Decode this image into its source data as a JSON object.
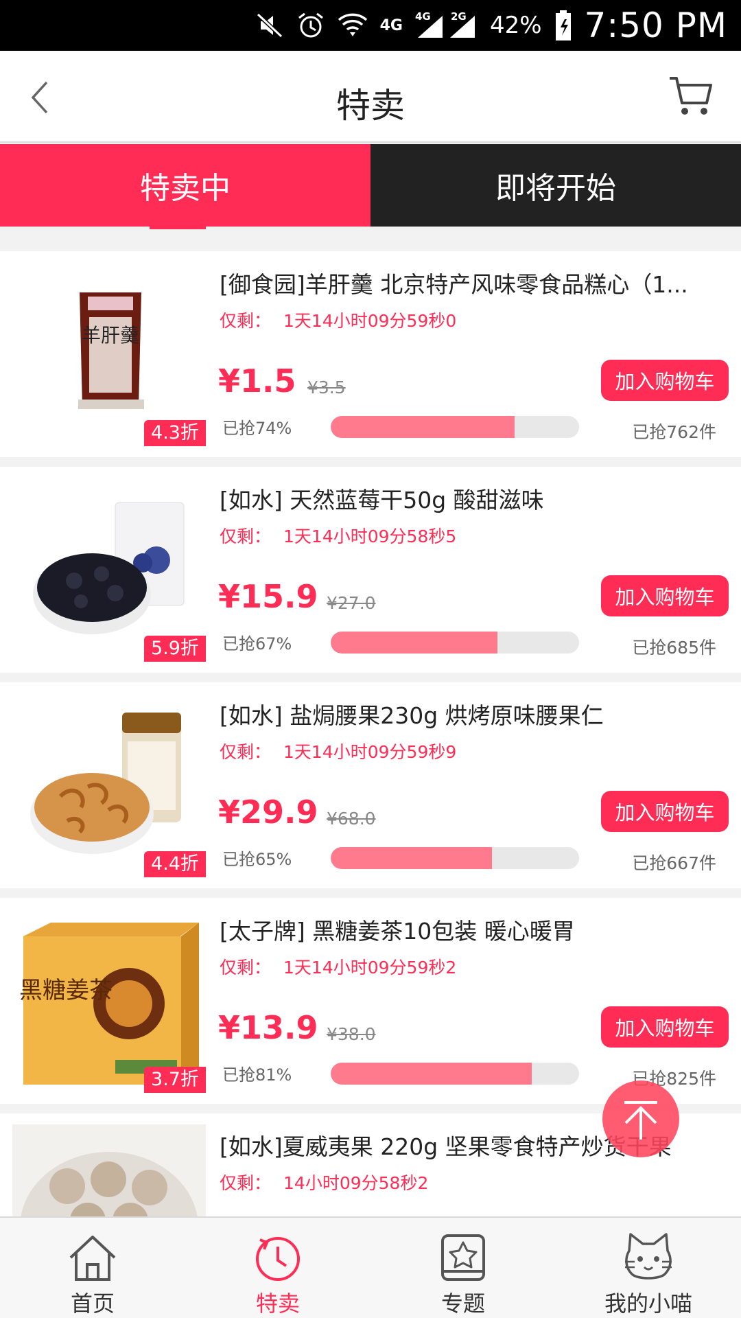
{
  "status_bar": {
    "network_1": "4G",
    "network_2": "4G",
    "network_3": "2G",
    "battery": "42%",
    "time": "7:50 PM",
    "icons": [
      "mute-icon",
      "alarm-icon",
      "wifi-icon",
      "signal-icon",
      "battery-icon"
    ]
  },
  "nav": {
    "title": "特卖",
    "back_icon": "chevron-left-icon",
    "cart_icon": "cart-icon"
  },
  "tabs": [
    {
      "label": "特卖中",
      "active": true
    },
    {
      "label": "即将开始",
      "active": false
    }
  ],
  "colors": {
    "accent": "#ff2d55",
    "tab_inactive": "#222222",
    "progress_fill": "#ff7a8c"
  },
  "products": [
    {
      "title": "[御食园]羊肝羹  北京特产风味零食品糕心（1...",
      "countdown_label": "仅剩：",
      "countdown": "1天14小时09分59秒0",
      "price": "¥1.5",
      "original_price": "¥3.5",
      "discount": "4.3折",
      "sold_percent_label": "已抢74%",
      "sold_fraction": 0.74,
      "sold_count": "已抢762件",
      "button": "加入购物车",
      "image_text": "羊肝羹"
    },
    {
      "title": "[如水] 天然蓝莓干50g 酸甜滋味",
      "countdown_label": "仅剩：",
      "countdown": "1天14小时09分58秒5",
      "price": "¥15.9",
      "original_price": "¥27.0",
      "discount": "5.9折",
      "sold_percent_label": "已抢67%",
      "sold_fraction": 0.67,
      "sold_count": "已抢685件",
      "button": "加入购物车"
    },
    {
      "title": "[如水] 盐焗腰果230g 烘烤原味腰果仁",
      "countdown_label": "仅剩：",
      "countdown": "1天14小时09分59秒9",
      "price": "¥29.9",
      "original_price": "¥68.0",
      "discount": "4.4折",
      "sold_percent_label": "已抢65%",
      "sold_fraction": 0.65,
      "sold_count": "已抢667件",
      "button": "加入购物车"
    },
    {
      "title": "[太子牌] 黑糖姜茶10包装 暖心暖胃",
      "countdown_label": "仅剩：",
      "countdown": "1天14小时09分59秒2",
      "price": "¥13.9",
      "original_price": "¥38.0",
      "discount": "3.7折",
      "sold_percent_label": "已抢81%",
      "sold_fraction": 0.81,
      "sold_count": "已抢825件",
      "button": "加入购物车",
      "image_text": "黑糖姜茶"
    },
    {
      "title": "[如水]夏威夷果 220g 坚果零食特产炒货干果",
      "countdown_label": "仅剩：",
      "countdown": "14小时09分58秒2"
    }
  ],
  "back_to_top_icon": "arrow-up-to-top-icon",
  "bottom_nav": [
    {
      "label": "首页",
      "icon": "home-icon",
      "active": false
    },
    {
      "label": "特卖",
      "icon": "clock-icon",
      "active": true
    },
    {
      "label": "专题",
      "icon": "star-tablet-icon",
      "active": false
    },
    {
      "label": "我的小喵",
      "icon": "cat-icon",
      "active": false
    }
  ]
}
